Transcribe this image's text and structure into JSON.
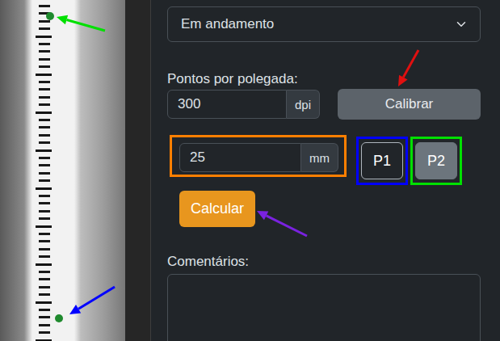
{
  "status_select": {
    "value": "Em andamento"
  },
  "dpi": {
    "label": "Pontos por polegada:",
    "value": "300",
    "unit": "dpi"
  },
  "calibrate_button": {
    "label": "Calibrar"
  },
  "distance": {
    "value": "25",
    "unit": "mm"
  },
  "points": [
    {
      "label": "P1",
      "selected": false,
      "color": "#0000ff"
    },
    {
      "label": "P2",
      "selected": true,
      "color": "#00e000"
    }
  ],
  "calculate_button": {
    "label": "Calcular"
  },
  "comments": {
    "label": "Comentários:",
    "value": ""
  }
}
